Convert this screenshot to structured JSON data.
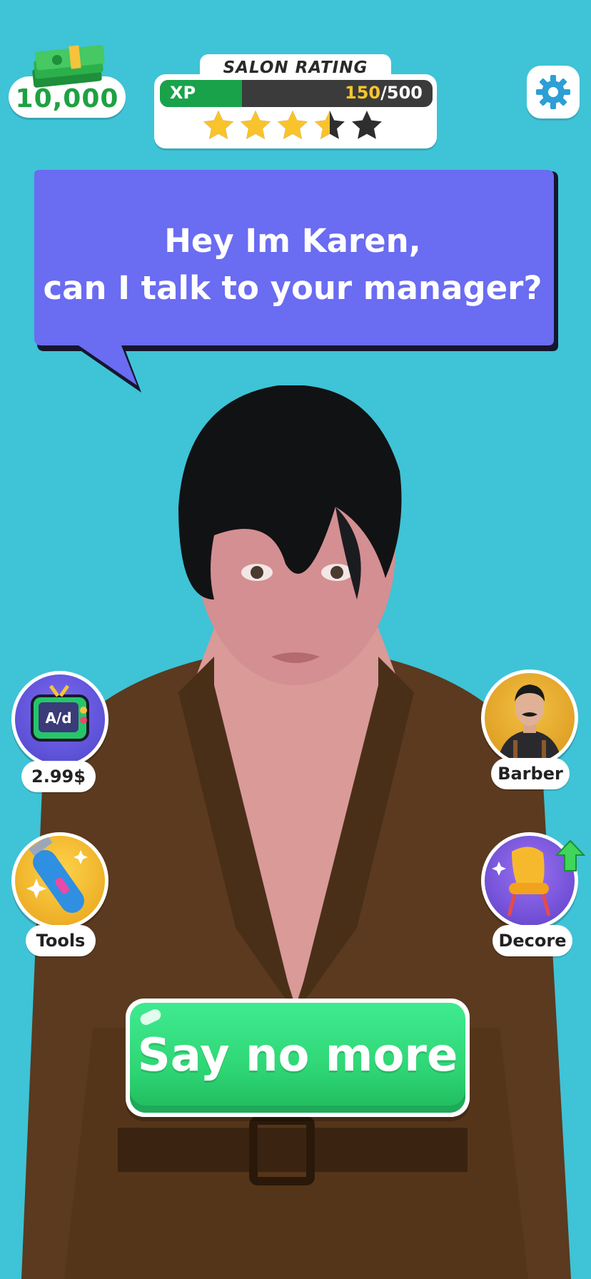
{
  "hud": {
    "cash": "10,000",
    "salon_rating": {
      "title": "SALON RATING",
      "xp_label": "XP",
      "xp_current": "150",
      "xp_max": "/500",
      "xp_progress": 0.3,
      "stars_rating": 3.5,
      "stars_max": 5
    }
  },
  "dialog": {
    "line1": "Hey Im Karen,",
    "line2": "can I talk to your manager?"
  },
  "side_buttons": {
    "ad": {
      "label": "2.99$",
      "icon": "ad-tv-icon"
    },
    "tools": {
      "label": "Tools",
      "icon": "hair-clipper-icon"
    },
    "barber": {
      "label": "Barber",
      "icon": "barber-portrait-icon"
    },
    "decore": {
      "label": "Decore",
      "icon": "chair-icon"
    }
  },
  "cta": {
    "label": "Say no more"
  },
  "colors": {
    "background": "#3fc3d6",
    "bubble": "#6a6cf2",
    "cash_green": "#1ea142",
    "xp_fill": "#1aa24b",
    "xp_current": "#f7c62c",
    "star": "#f9c32c",
    "cta_green": "#2fd675"
  }
}
